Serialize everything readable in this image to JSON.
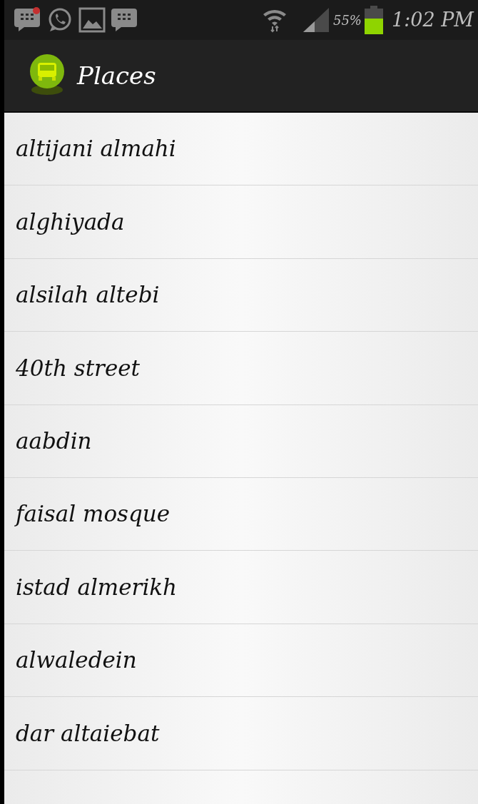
{
  "status_bar": {
    "battery_text": "55%",
    "time": "1:02 PM"
  },
  "action_bar": {
    "title": "Places"
  },
  "places": [
    {
      "name": "altijani almahi"
    },
    {
      "name": "alghiyada"
    },
    {
      "name": "alsilah altebi"
    },
    {
      "name": "40th street"
    },
    {
      "name": "aabdin"
    },
    {
      "name": "faisal mosque"
    },
    {
      "name": "istad almerikh"
    },
    {
      "name": "alwaledein"
    },
    {
      "name": "dar altaiebat"
    }
  ]
}
